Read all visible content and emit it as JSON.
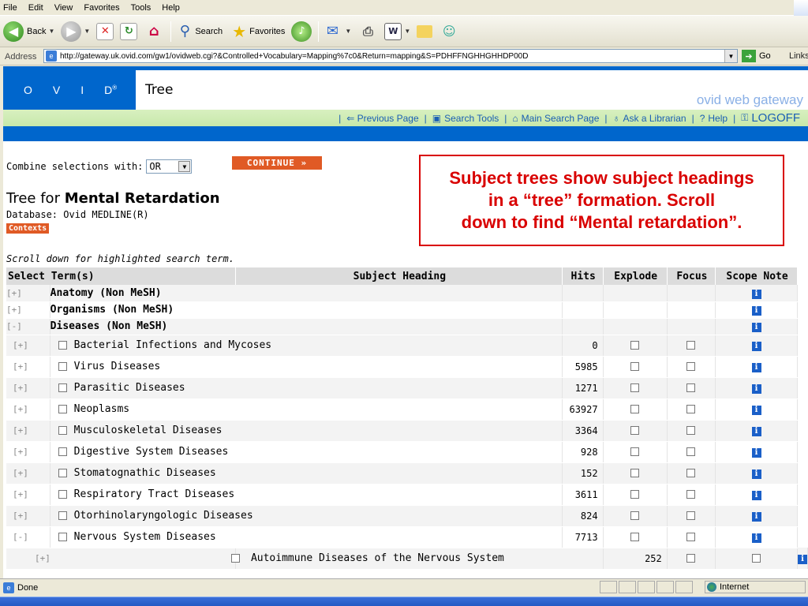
{
  "menu": [
    "File",
    "Edit",
    "View",
    "Favorites",
    "Tools",
    "Help"
  ],
  "toolbar": {
    "back": "Back",
    "search": "Search",
    "favorites": "Favorites"
  },
  "address": {
    "label": "Address",
    "url": "http://gateway.uk.ovid.com/gw1/ovidweb.cgi?&Controlled+Vocabulary=Mapping%7c0&Return=mapping&S=PDHFFNGHHGHHDP00D",
    "go": "Go",
    "links": "Links"
  },
  "brand": {
    "logo_letters": [
      "O",
      "V",
      "I",
      "D"
    ],
    "logo_mark": "®",
    "page_title": "Tree",
    "gateway": "ovid web gateway"
  },
  "nav": {
    "previous": "⇐ Previous Page",
    "tools": "Search Tools",
    "main": "Main Search Page",
    "librarian": "Ask a Librarian",
    "help": "Help",
    "logoff": "LOGOFF"
  },
  "combine": {
    "label": "Combine selections with:",
    "value": "OR",
    "continue": "CONTINUE »"
  },
  "tree": {
    "title_prefix": "Tree for ",
    "title_term": "Mental Retardation",
    "database": "Database: Ovid MEDLINE(R)",
    "contexts": "Contexts",
    "scroll_note": "Scroll down for highlighted search term."
  },
  "annotation": {
    "line1": "Subject trees show subject headings",
    "line2": "in a “tree” formation.  Scroll",
    "line3": "down to find “Mental retardation”."
  },
  "table": {
    "headers": {
      "select": "Select Term(s)",
      "subject": "Subject Heading",
      "hits": "Hits",
      "explode": "Explode",
      "focus": "Focus",
      "scope": "Scope Note"
    },
    "top_rows": [
      {
        "exp": "[+]",
        "term": "Anatomy (Non MeSH)"
      },
      {
        "exp": "[+]",
        "term": "Organisms (Non MeSH)"
      },
      {
        "exp": "[-]",
        "term": "Diseases (Non MeSH)"
      }
    ],
    "rows": [
      {
        "exp": "[+]",
        "term": "Bacterial Infections and Mycoses",
        "hits": "0"
      },
      {
        "exp": "[+]",
        "term": "Virus Diseases",
        "hits": "5985"
      },
      {
        "exp": "[+]",
        "term": "Parasitic Diseases",
        "hits": "1271"
      },
      {
        "exp": "[+]",
        "term": "Neoplasms",
        "hits": "63927"
      },
      {
        "exp": "[+]",
        "term": "Musculoskeletal Diseases",
        "hits": "3364"
      },
      {
        "exp": "[+]",
        "term": "Digestive System Diseases",
        "hits": "928"
      },
      {
        "exp": "[+]",
        "term": "Stomatognathic Diseases",
        "hits": "152"
      },
      {
        "exp": "[+]",
        "term": "Respiratory Tract Diseases",
        "hits": "3611"
      },
      {
        "exp": "[+]",
        "term": "Otorhinolaryngologic Diseases",
        "hits": "824"
      },
      {
        "exp": "[-]",
        "term": "Nervous System Diseases",
        "hits": "7713"
      }
    ],
    "nested_row": {
      "exp": "[+]",
      "term": "Autoimmune Diseases of the Nervous System",
      "hits": "252"
    }
  },
  "status": {
    "text": "Done",
    "zone": "Internet"
  }
}
